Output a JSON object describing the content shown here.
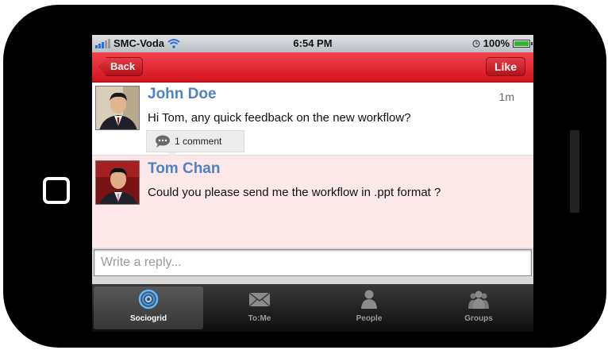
{
  "status_bar": {
    "carrier": "SMC-Voda",
    "time": "6:54 PM",
    "battery": "100%",
    "battery_level": 1.0,
    "icons": [
      "signal-icon",
      "wifi-icon",
      "alarm-icon",
      "battery-icon"
    ]
  },
  "nav": {
    "back_label": "Back",
    "like_label": "Like"
  },
  "posts": [
    {
      "author": "John Doe",
      "time": "1m",
      "text": "Hi Tom, any quick feedback on the new workflow?",
      "comments": "1 comment"
    },
    {
      "author": "Tom Chan",
      "text": "Could you please send me the workflow in .ppt format ?"
    }
  ],
  "reply": {
    "placeholder": "Write a reply..."
  },
  "tabs": [
    {
      "label": "Sociogrid",
      "icon": "sociogrid-swirl-icon",
      "active": true
    },
    {
      "label": "To:Me",
      "icon": "envelope-icon",
      "active": false
    },
    {
      "label": "People",
      "icon": "person-icon",
      "active": false
    },
    {
      "label": "Groups",
      "icon": "group-icon",
      "active": false
    }
  ],
  "colors": {
    "navbar": "#e02a34",
    "author_name": "#4f82c4",
    "highlight_row": "#fce8e8",
    "tabbar": "#1a1a1a"
  }
}
